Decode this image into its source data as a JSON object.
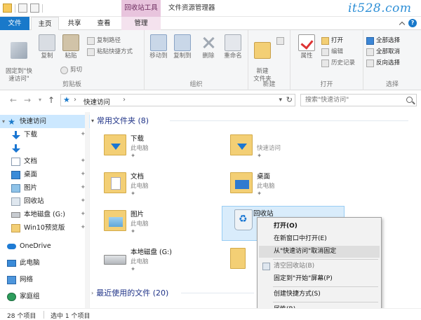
{
  "window": {
    "context_tab_title": "回收站工具",
    "title": "文件资源管理器",
    "brand": "it528.com"
  },
  "ribbon_tabs": [
    {
      "label": "文件"
    },
    {
      "label": "主页"
    },
    {
      "label": "共享"
    },
    {
      "label": "查看"
    },
    {
      "label": "管理"
    }
  ],
  "ribbon": {
    "clipboard": {
      "group_label": "剪贴板",
      "pin_quick_access": "固定到\"快\n速访问\"",
      "copy": "复制",
      "paste": "粘贴",
      "copy_path": "复制路径",
      "paste_shortcut": "粘贴快捷方式",
      "cut": "剪切"
    },
    "organize": {
      "group_label": "组织",
      "move_to": "移动到",
      "copy_to": "复制到",
      "delete": "删除",
      "rename": "重命名"
    },
    "new": {
      "group_label": "新建",
      "new_folder": "新建\n文件夹"
    },
    "open": {
      "group_label": "打开",
      "properties": "属性",
      "open": "打开",
      "edit": "编辑",
      "history": "历史记录"
    },
    "select": {
      "group_label": "选择",
      "select_all": "全部选择",
      "select_none": "全部取消",
      "invert": "反向选择"
    }
  },
  "address": {
    "crumb": "快速访问",
    "search_placeholder": "搜索\"快速访问\""
  },
  "sidebar": {
    "items": [
      {
        "label": "快速访问"
      },
      {
        "label": "下载"
      },
      {
        "label": "文档"
      },
      {
        "label": "桌面"
      },
      {
        "label": "图片"
      },
      {
        "label": "回收站"
      },
      {
        "label": "本地磁盘 (G:)"
      },
      {
        "label": "Win10预览版"
      },
      {
        "label": "OneDrive"
      },
      {
        "label": "此电脑"
      },
      {
        "label": "网络"
      },
      {
        "label": "家庭组"
      }
    ]
  },
  "content": {
    "frequent_header": "常用文件夹 (8)",
    "recent_header": "最近使用的文件 (20)",
    "tiles": [
      {
        "name": "下载",
        "sub": "此电脑",
        "icon": "download-folder-icon"
      },
      {
        "name": "",
        "sub": "快速访问",
        "icon": "download-folder-icon"
      },
      {
        "name": "文档",
        "sub": "此电脑",
        "icon": "documents-folder-icon"
      },
      {
        "name": "桌面",
        "sub": "此电脑",
        "icon": "desktop-folder-icon"
      },
      {
        "name": "图片",
        "sub": "此电脑",
        "icon": "pictures-folder-icon"
      },
      {
        "name": "回收站",
        "sub": "",
        "icon": "recycle-bin-icon"
      },
      {
        "name": "本地磁盘 (G:)",
        "sub": "此电脑",
        "icon": "drive-icon"
      }
    ]
  },
  "context_menu": {
    "items": [
      {
        "label": "打开(O)"
      },
      {
        "label": "在新窗口中打开(E)"
      },
      {
        "label": "从\"快速访问\"取消固定"
      },
      {
        "label": "清空回收站(B)"
      },
      {
        "label": "固定到\"开始\"屏幕(P)"
      },
      {
        "label": "创建快捷方式(S)"
      },
      {
        "label": "属性(R)"
      }
    ]
  },
  "status": {
    "count": "28 个项目",
    "selected": "选中 1 个项目"
  },
  "colors": {
    "accent": "#1979ca",
    "context_tab": "#e8c4dd",
    "selection": "#cce8ff"
  }
}
